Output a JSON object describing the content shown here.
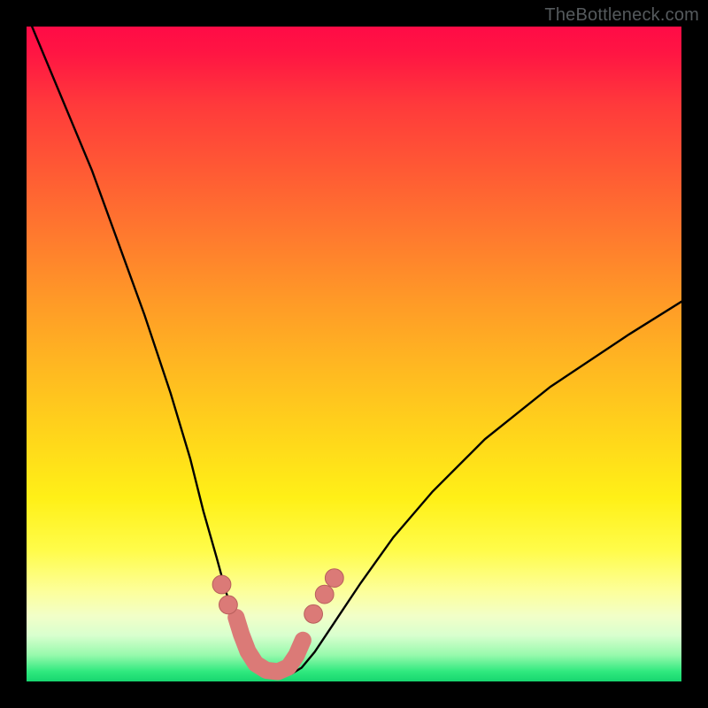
{
  "watermark": {
    "text": "TheBottleneck.com"
  },
  "colors": {
    "frame": "#000000",
    "curve": "#000000",
    "marker_fill": "#db7a77",
    "marker_stroke": "#b85f5c",
    "gradient_top": "#ff0b46",
    "gradient_bottom": "#17d66f"
  },
  "chart_data": {
    "type": "line",
    "title": "",
    "xlabel": "",
    "ylabel": "",
    "xlim": [
      0,
      100
    ],
    "ylim": [
      0,
      100
    ],
    "grid": false,
    "legend": false,
    "background": "rainbow-gradient-vertical",
    "series": [
      {
        "name": "bottleneck-curve",
        "x": [
          0,
          5,
          10,
          14,
          18,
          22,
          25,
          27,
          29,
          30.5,
          32,
          33,
          34,
          35,
          36,
          37.5,
          39,
          40.5,
          42,
          44,
          47,
          51,
          56,
          62,
          70,
          80,
          92,
          100
        ],
        "y": [
          102,
          90,
          78,
          67,
          56,
          44,
          34,
          26,
          19,
          13.5,
          9.5,
          6.7,
          4.7,
          3.1,
          2.1,
          1.2,
          0.9,
          1.2,
          2.1,
          4.5,
          9,
          15,
          22,
          29,
          37,
          45,
          53,
          58
        ]
      }
    ],
    "markers": [
      {
        "name": "left-upper-dot",
        "x": 29.8,
        "y": 14.8,
        "r": 1.4
      },
      {
        "name": "left-lower-dot",
        "x": 30.8,
        "y": 11.7,
        "r": 1.4
      },
      {
        "name": "right-lower-dot",
        "x": 43.8,
        "y": 10.3,
        "r": 1.4
      },
      {
        "name": "right-mid-dot",
        "x": 45.5,
        "y": 13.3,
        "r": 1.4
      },
      {
        "name": "right-upper-dot",
        "x": 47.0,
        "y": 15.8,
        "r": 1.4
      }
    ],
    "valley_path": {
      "name": "valley-worm",
      "points": [
        {
          "x": 32.0,
          "y": 9.8
        },
        {
          "x": 32.8,
          "y": 7.2
        },
        {
          "x": 33.8,
          "y": 4.6
        },
        {
          "x": 35.0,
          "y": 2.7
        },
        {
          "x": 36.6,
          "y": 1.7
        },
        {
          "x": 38.4,
          "y": 1.5
        },
        {
          "x": 40.0,
          "y": 2.2
        },
        {
          "x": 41.2,
          "y": 4.0
        },
        {
          "x": 42.2,
          "y": 6.3
        }
      ],
      "width": 2.6
    }
  }
}
